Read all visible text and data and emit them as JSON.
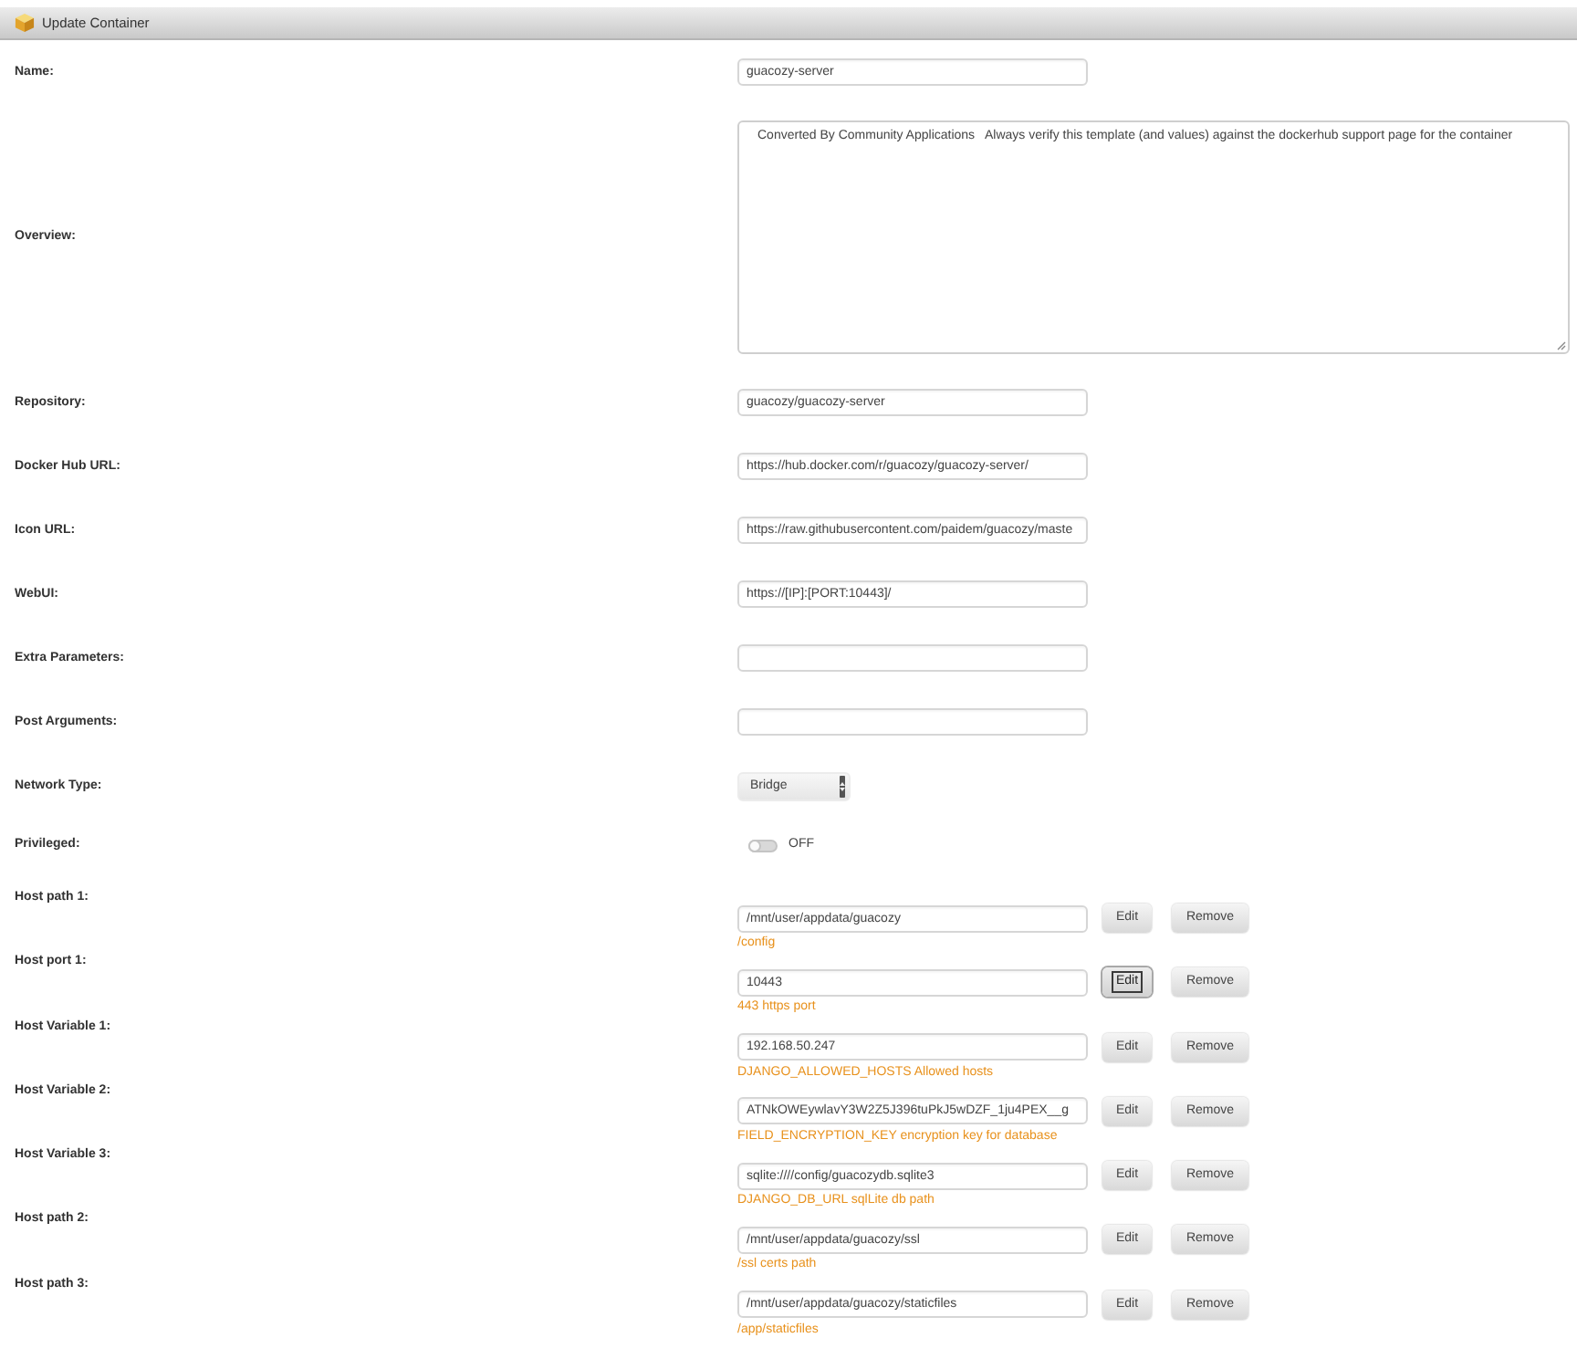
{
  "window": {
    "title": "Update Container"
  },
  "fields": [
    {
      "kind": "text",
      "label": "Name:",
      "value": "guacozy-server"
    },
    {
      "kind": "textarea",
      "label": "Overview:",
      "value": "Converted By Community Applications   Always verify this template (and values) against the dockerhub support page for the container"
    },
    {
      "kind": "text",
      "label": "Repository:",
      "value": "guacozy/guacozy-server"
    },
    {
      "kind": "text",
      "label": "Docker Hub URL:",
      "value": "https://hub.docker.com/r/guacozy/guacozy-server/"
    },
    {
      "kind": "text",
      "label": "Icon URL:",
      "value": "https://raw.githubusercontent.com/paidem/guacozy/maste"
    },
    {
      "kind": "text",
      "label": "WebUI:",
      "value": "https://[IP]:[PORT:10443]/"
    },
    {
      "kind": "text",
      "label": "Extra Parameters:"
    },
    {
      "kind": "text",
      "label": "Post Arguments:"
    },
    {
      "kind": "select",
      "label": "Network Type:",
      "value": "Bridge"
    },
    {
      "kind": "toggle",
      "label": "Privileged:",
      "on": false,
      "state_text": "OFF"
    },
    {
      "kind": "host",
      "label": "Host path 1:",
      "value": "/mnt/user/appdata/guacozy",
      "description": "/config",
      "edit": {
        "label": "Edit",
        "focused": false
      },
      "remove": {
        "label": "Remove"
      }
    },
    {
      "kind": "host",
      "label": "Host port 1:",
      "value": "10443",
      "description": "443 https port",
      "edit": {
        "label": "Edit",
        "focused": true
      },
      "remove": {
        "label": "Remove"
      }
    },
    {
      "kind": "host",
      "label": "Host Variable 1:",
      "value": "192.168.50.247",
      "description": "DJANGO_ALLOWED_HOSTS Allowed hosts",
      "edit": {
        "label": "Edit",
        "focused": false
      },
      "remove": {
        "label": "Remove"
      }
    },
    {
      "kind": "host",
      "label": "Host Variable 2:",
      "value": "ATNkOWEywlavY3W2Z5J396tuPkJ5wDZF_1ju4PEX__g",
      "description": "FIELD_ENCRYPTION_KEY encryption key for database",
      "edit": {
        "label": "Edit",
        "focused": false
      },
      "remove": {
        "label": "Remove"
      }
    },
    {
      "kind": "host",
      "label": "Host Variable 3:",
      "value": "sqlite:////config/guacozydb.sqlite3",
      "description": "DJANGO_DB_URL sqlLite db path",
      "edit": {
        "label": "Edit",
        "focused": false
      },
      "remove": {
        "label": "Remove"
      }
    },
    {
      "kind": "host",
      "label": "Host path 2:",
      "value": "/mnt/user/appdata/guacozy/ssl",
      "description": "/ssl certs path",
      "edit": {
        "label": "Edit",
        "focused": false
      },
      "remove": {
        "label": "Remove"
      }
    },
    {
      "kind": "host",
      "label": "Host path 3:",
      "value": "/mnt/user/appdata/guacozy/staticfiles",
      "description": "/app/staticfiles",
      "edit": {
        "label": "Edit",
        "focused": false
      },
      "remove": {
        "label": "Remove"
      }
    }
  ]
}
